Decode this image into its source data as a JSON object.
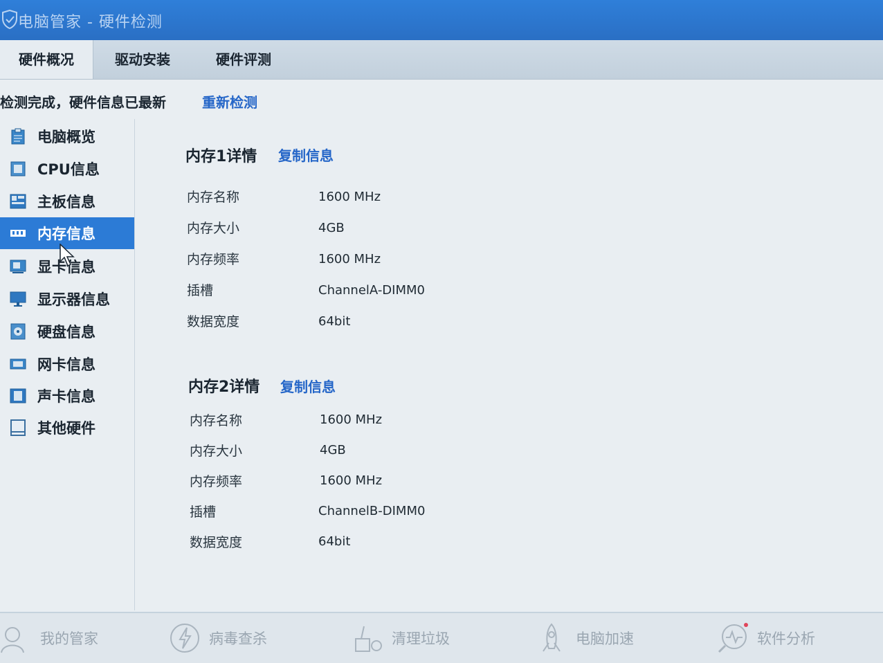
{
  "window": {
    "title": "电脑管家 - 硬件检测",
    "title_icon": "shield-check-icon"
  },
  "tabs": [
    {
      "label": "硬件概况",
      "active": true
    },
    {
      "label": "驱动安装",
      "active": false
    },
    {
      "label": "硬件评测",
      "active": false
    }
  ],
  "status": {
    "text": "检测完成，硬件信息已最新",
    "redetect_label": "重新检测"
  },
  "sidebar": {
    "items": [
      {
        "label": "电脑概览",
        "icon": "clipboard-icon"
      },
      {
        "label": "CPU信息",
        "icon": "cpu-icon"
      },
      {
        "label": "主板信息",
        "icon": "motherboard-icon"
      },
      {
        "label": "内存信息",
        "icon": "memory-icon",
        "active": true
      },
      {
        "label": "显卡信息",
        "icon": "graphics-card-icon"
      },
      {
        "label": "显示器信息",
        "icon": "monitor-icon"
      },
      {
        "label": "硬盘信息",
        "icon": "disk-icon"
      },
      {
        "label": "网卡信息",
        "icon": "network-card-icon"
      },
      {
        "label": "声卡信息",
        "icon": "sound-card-icon"
      },
      {
        "label": "其他硬件",
        "icon": "other-hardware-icon"
      }
    ]
  },
  "memory": [
    {
      "title": "内存1详情",
      "copy_label": "复制信息",
      "rows": [
        {
          "label": "内存名称",
          "value": "1600 MHz"
        },
        {
          "label": "内存大小",
          "value": "4GB"
        },
        {
          "label": "内存频率",
          "value": "1600 MHz"
        },
        {
          "label": "插槽",
          "value": "ChannelA-DIMM0"
        },
        {
          "label": "数据宽度",
          "value": "64bit"
        }
      ]
    },
    {
      "title": "内存2详情",
      "copy_label": "复制信息",
      "rows": [
        {
          "label": "内存名称",
          "value": "1600 MHz"
        },
        {
          "label": "内存大小",
          "value": "4GB"
        },
        {
          "label": "内存频率",
          "value": "1600 MHz"
        },
        {
          "label": "插槽",
          "value": "ChannelB-DIMM0"
        },
        {
          "label": "数据宽度",
          "value": "64bit"
        }
      ]
    }
  ],
  "bottom_nav": [
    {
      "label": "我的管家",
      "icon": "person-icon"
    },
    {
      "label": "病毒查杀",
      "icon": "lightning-shield-icon"
    },
    {
      "label": "清理垃圾",
      "icon": "broom-icon"
    },
    {
      "label": "电脑加速",
      "icon": "rocket-icon"
    },
    {
      "label": "软件分析",
      "icon": "software-analysis-icon"
    }
  ],
  "colors": {
    "titlebar": "#2f7fd9",
    "accent": "#2566c8",
    "selected": "#2c7bd6"
  }
}
